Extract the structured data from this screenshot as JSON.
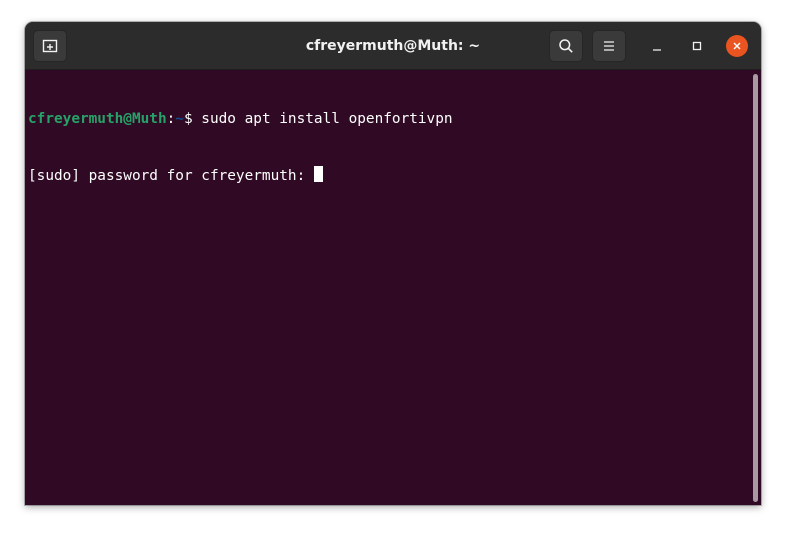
{
  "window": {
    "title": "cfreyermuth@Muth: ~"
  },
  "toolbar": {
    "new_tab_icon": "new-tab-icon",
    "search_icon": "search-icon",
    "menu_icon": "hamburger-menu-icon",
    "minimize_icon": "minimize-icon",
    "maximize_icon": "maximize-icon",
    "close_icon": "close-icon"
  },
  "terminal": {
    "lines": [
      {
        "user_host": "cfreyermuth@Muth",
        "separator": ":",
        "path": "~",
        "symbol": "$ ",
        "command": "sudo apt install openfortivpn"
      },
      {
        "text": "[sudo] password for cfreyermuth: "
      }
    ]
  },
  "colors": {
    "terminal_bg": "#300a24",
    "prompt_user": "#26a269",
    "prompt_path": "#12488b",
    "close_button": "#e95420",
    "headerbar_bg": "#2c2c2c"
  }
}
